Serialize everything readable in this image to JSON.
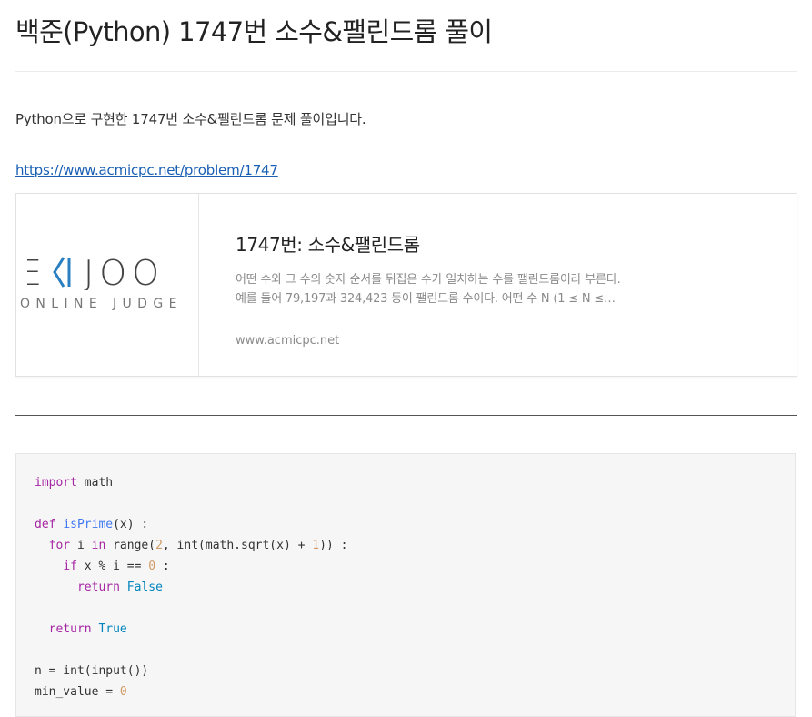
{
  "post": {
    "title": "백준(Python) 1747번 소수&팰린드롬 풀이",
    "intro": "Python으로 구현한 1747번 소수&팰린드롬 문제 풀이입니다.",
    "link_text": "https://www.acmicpc.net/problem/1747"
  },
  "link_card": {
    "logo_main": "BAEKJOON",
    "logo_sub": "ONLINE JUDGE",
    "title": "1747번: 소수&팰린드롬",
    "desc_line1": "어떤 수와 그 수의 숫자 순서를 뒤집은 수가 일치하는 수를 팰린드롬이라 부른다.",
    "desc_line2": "예를 들어 79,197과 324,423 등이 팰린드롬 수이다. 어떤 수 N (1 ≤ N ≤…",
    "url": "www.acmicpc.net"
  },
  "code": {
    "language": "python",
    "lines": [
      "import math",
      "",
      "def isPrime(x) :",
      "  for i in range(2, int(math.sqrt(x) + 1)) :",
      "    if x % i == 0 :",
      "      return False",
      "",
      "  return True",
      "",
      "n = int(input())",
      "min_value = 0"
    ]
  },
  "colors": {
    "link": "#1a5fb4",
    "keyword": "#a626a4",
    "function": "#4078f2",
    "number": "#d19a66",
    "builtin_const": "#0184bc",
    "logo_accent": "#2a7fc1"
  }
}
